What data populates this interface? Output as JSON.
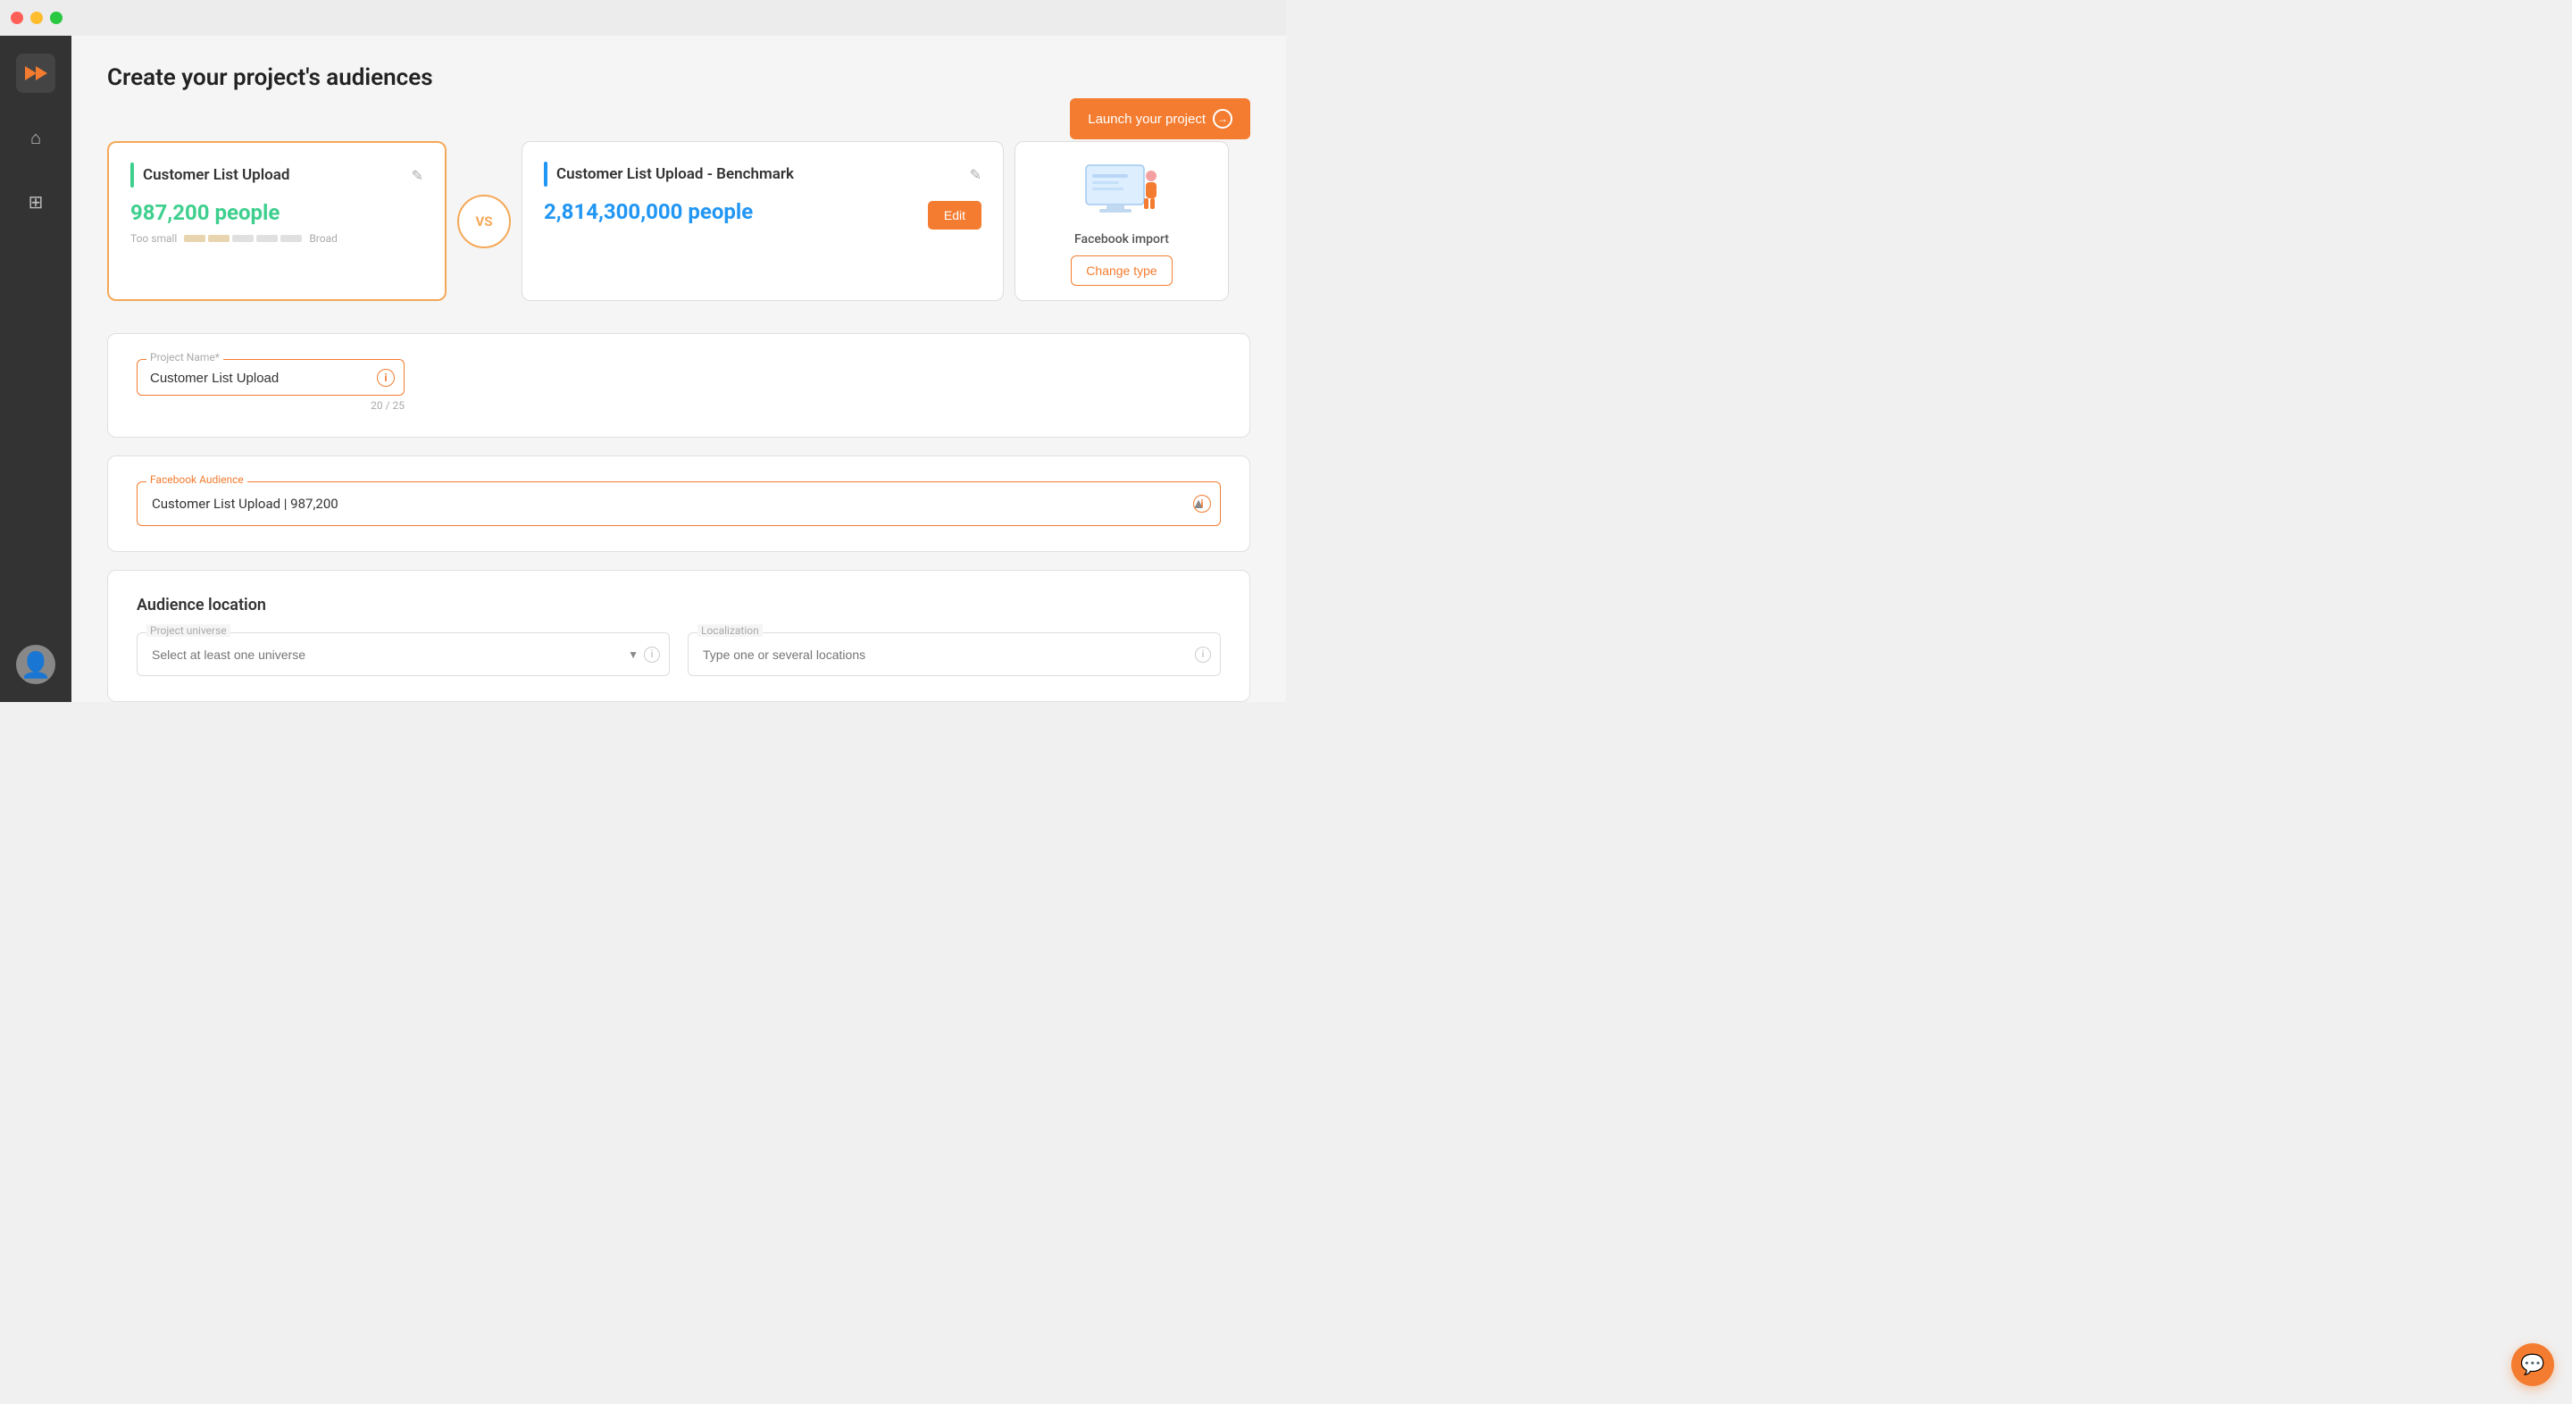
{
  "titlebar": {
    "buttons": [
      "red",
      "yellow",
      "green"
    ]
  },
  "sidebar": {
    "logo_label": "logo",
    "items": [
      {
        "name": "home",
        "icon": "⌂"
      },
      {
        "name": "add",
        "icon": "⊞"
      }
    ],
    "avatar_label": "user-avatar"
  },
  "header": {
    "title": "Create your project's audiences",
    "launch_button": "Launch your project"
  },
  "audience_card_left": {
    "title": "Customer List Upload",
    "people_count": "987,200 people",
    "size_label_small": "Too small",
    "size_label_broad": "Broad",
    "edit_icon_label": "✎"
  },
  "vs_label": "VS",
  "audience_card_right": {
    "title": "Customer List Upload - Benchmark",
    "people_count": "2,814,300,000 people",
    "edit_button_label": "Edit",
    "edit_icon_label": "✎"
  },
  "facebook_import_card": {
    "label": "Facebook import",
    "change_type_button": "Change type"
  },
  "project_name_section": {
    "field_label": "Project Name*",
    "field_value": "Customer List Upload",
    "char_count": "20 / 25",
    "info_icon": "i"
  },
  "facebook_audience_section": {
    "field_label": "Facebook Audience",
    "field_value": "Customer List Upload | 987,200",
    "info_icon": "i"
  },
  "audience_location_section": {
    "heading": "Audience location",
    "project_universe_label": "Project universe",
    "project_universe_placeholder": "Select at least one universe",
    "localization_label": "Localization",
    "localization_placeholder": "Type one or several locations",
    "info_icon": "i",
    "dropdown_arrow": "▼"
  },
  "chat_widget": {
    "icon": "💬"
  }
}
